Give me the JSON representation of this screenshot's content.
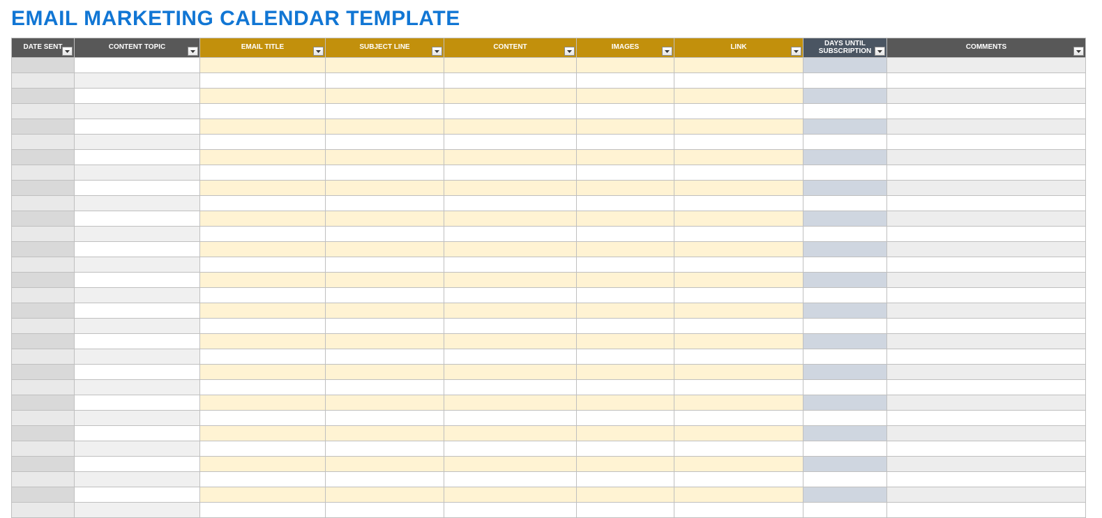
{
  "title": "EMAIL MARKETING CALENDAR TEMPLATE",
  "columns": [
    {
      "key": "date_sent",
      "label": "DATE SENT",
      "group": "gray"
    },
    {
      "key": "content_topic",
      "label": "CONTENT TOPIC",
      "group": "gray"
    },
    {
      "key": "email_title",
      "label": "EMAIL TITLE",
      "group": "gold"
    },
    {
      "key": "subject_line",
      "label": "SUBJECT LINE",
      "group": "gold"
    },
    {
      "key": "content",
      "label": "CONTENT",
      "group": "gold"
    },
    {
      "key": "images",
      "label": "IMAGES",
      "group": "gold"
    },
    {
      "key": "link",
      "label": "LINK",
      "group": "gold"
    },
    {
      "key": "days_until_subscription",
      "label": "DAYS UNTIL\nSUBSCRIPTION",
      "group": "slate"
    },
    {
      "key": "comments",
      "label": "COMMENTS",
      "group": "gray"
    }
  ],
  "row_count": 30,
  "colors": {
    "brand_blue": "#1176d4",
    "header_gray": "#585858",
    "header_gold": "#c2900c",
    "header_slate": "#4a5562"
  }
}
